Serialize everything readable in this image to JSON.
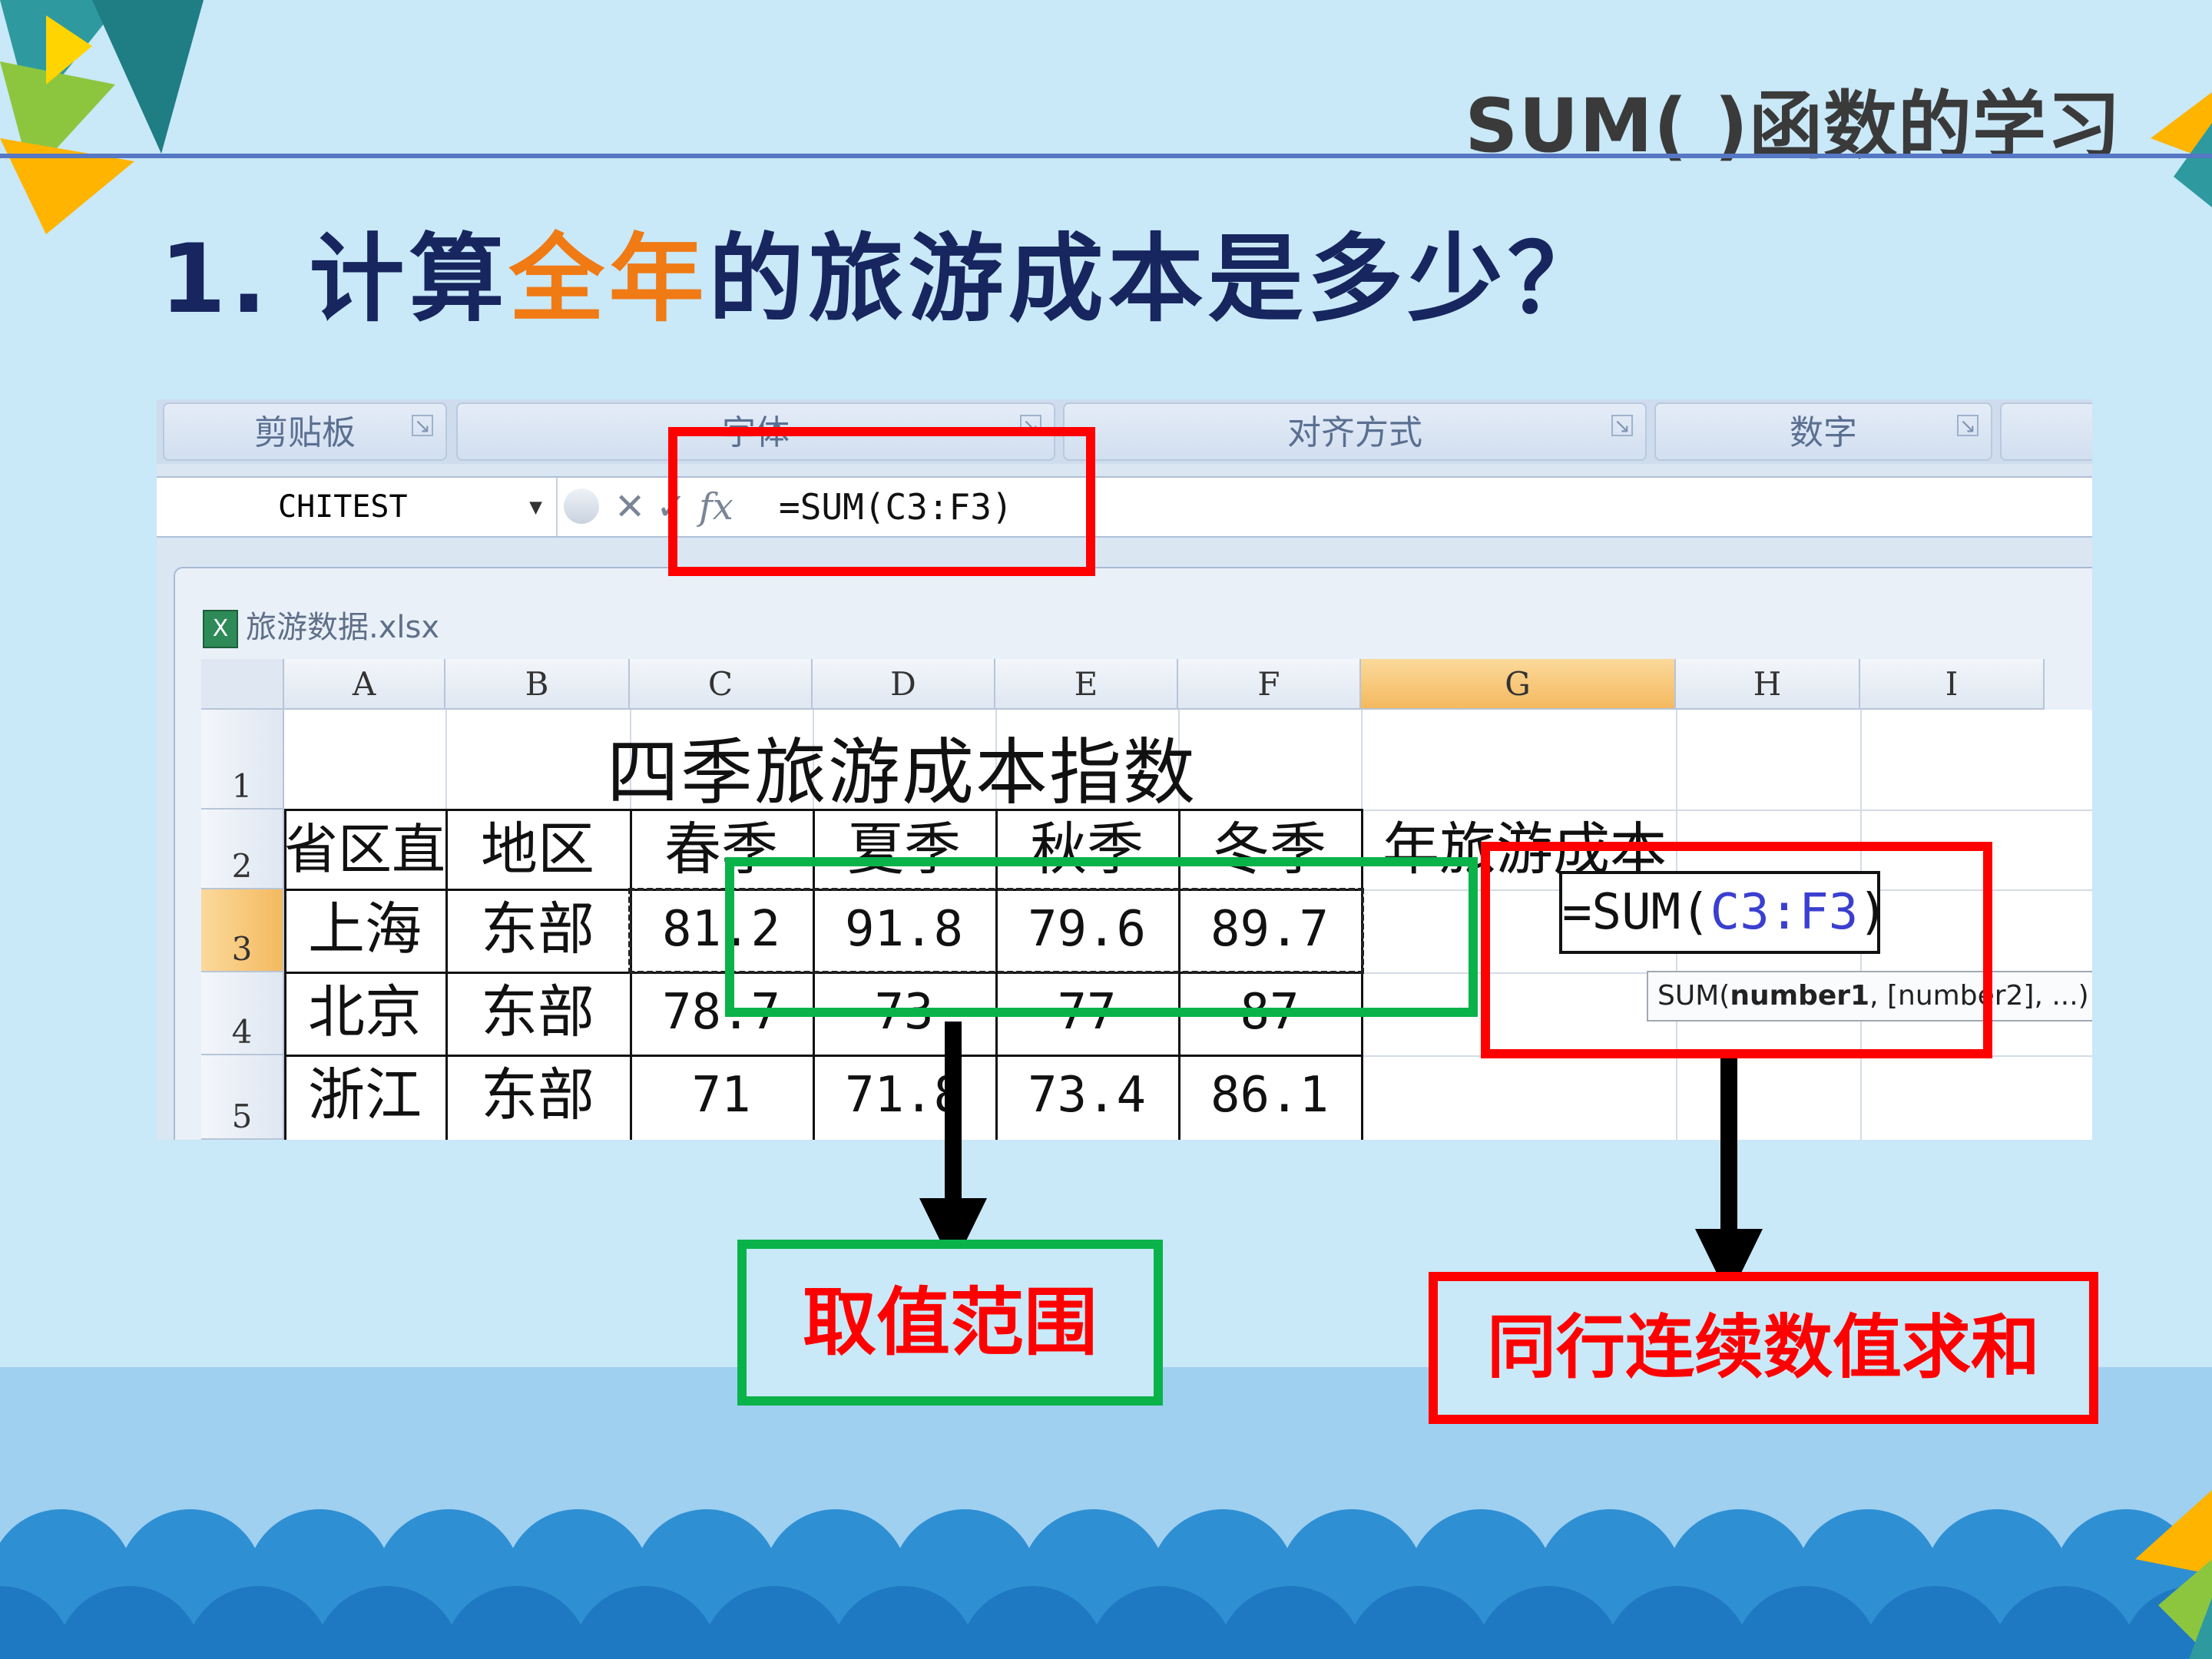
{
  "slide": {
    "title": "SUM(  )函数的学习",
    "question_prefix": "1. 计算",
    "question_highlight": "全年",
    "question_suffix": "的旅游成本是多少？"
  },
  "ribbon": {
    "groups": [
      "剪贴板",
      "字体",
      "对齐方式",
      "数字"
    ]
  },
  "formula_bar": {
    "name_box": "CHITEST",
    "fx_symbol": "fx",
    "cancel_symbol": "✕",
    "enter_symbol": "✓",
    "formula": "=SUM(C3:F3)"
  },
  "workbook": {
    "filename": "旅游数据.xlsx",
    "columns": [
      "A",
      "B",
      "C",
      "D",
      "E",
      "F",
      "G",
      "H",
      "I"
    ],
    "rows": [
      "1",
      "2",
      "3",
      "4",
      "5"
    ],
    "sheet_title": "四季旅游成本指数",
    "headers": [
      "省区直辖市",
      "地区",
      "春季",
      "夏季",
      "秋季",
      "冬季",
      "年旅游成本"
    ],
    "data": [
      [
        "上海",
        "东部",
        "81.2",
        "91.8",
        "79.6",
        "89.7"
      ],
      [
        "北京",
        "东部",
        "78.7",
        "73",
        "77",
        "87"
      ],
      [
        "浙江",
        "东部",
        "71",
        "71.8",
        "73.4",
        "86.1"
      ]
    ],
    "editing_cell": {
      "prefix": "=SUM(",
      "ref": "C3:F3",
      "suffix": ")"
    },
    "tooltip": {
      "func": "SUM(",
      "arg1": "number1",
      "rest": ", [number2], ...)"
    }
  },
  "annotations": {
    "range_label": "取值范围",
    "sum_label": "同行连续数值求和"
  },
  "colors": {
    "accent_red": "#ff0000",
    "accent_green": "#0ab34a",
    "highlight_orange": "#f07a14",
    "title_navy": "#17265e"
  }
}
